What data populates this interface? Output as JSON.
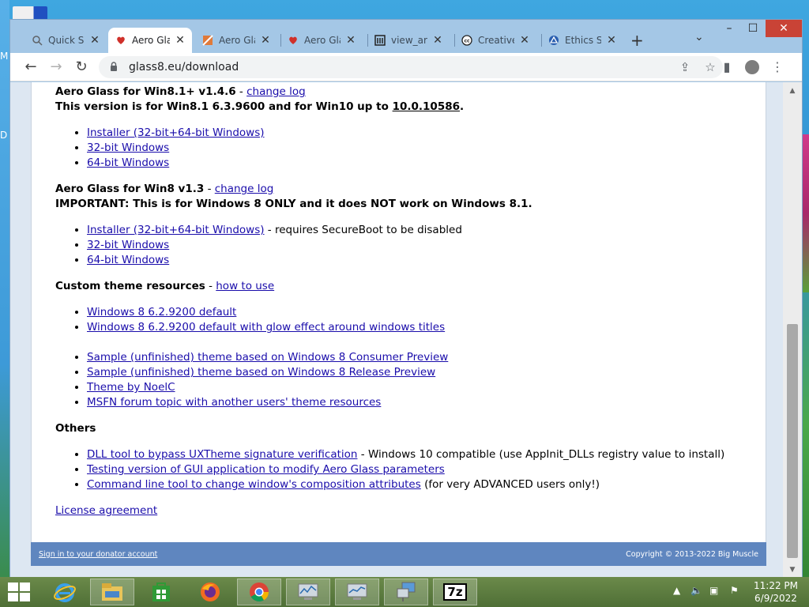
{
  "desktop": {
    "glyph_top": "M",
    "glyph_bottom": "D"
  },
  "browser": {
    "tabs": [
      {
        "title": "Quick Se",
        "icon": "search-icon",
        "active": false
      },
      {
        "title": "Aero Gla",
        "icon": "aero-favicon",
        "active": true
      },
      {
        "title": "Aero Gla",
        "icon": "glass-favicon",
        "active": false
      },
      {
        "title": "Aero Gla",
        "icon": "aero-favicon",
        "active": false
      },
      {
        "title": "view_arc",
        "icon": "archive-favicon",
        "active": false
      },
      {
        "title": "Creative",
        "icon": "cc-favicon",
        "active": false
      },
      {
        "title": "Ethics St",
        "icon": "ethics-favicon",
        "active": false
      }
    ],
    "url": "glass8.eu/download"
  },
  "page": {
    "s1": {
      "title": "Aero Glass for Win8.1+ v1.4.6",
      "sep": " - ",
      "link": "change log",
      "note_prefix": "This version is for Win8.1 6.3.9600 and for Win10 up to ",
      "note_link": "10.0.10586",
      "note_suffix": ".",
      "items": [
        "Installer (32-bit+64-bit Windows)",
        "32-bit Windows",
        "64-bit Windows"
      ]
    },
    "s2": {
      "title": "Aero Glass for Win8 v1.3",
      "sep": " - ",
      "link": "change log",
      "note": "IMPORTANT: This is for Windows 8 ONLY and it does NOT work on Windows 8.1.",
      "items": [
        "Installer (32-bit+64-bit Windows)",
        "32-bit Windows",
        "64-bit Windows"
      ],
      "item1_suffix": " - requires SecureBoot to be disabled"
    },
    "s3": {
      "title": "Custom theme resources",
      "sep": " - ",
      "link": "how to use",
      "items_a": [
        "Windows 8 6.2.9200 default",
        "Windows 8 6.2.9200 default with glow effect around windows titles"
      ],
      "items_b": [
        "Sample (unfinished) theme based on Windows 8 Consumer Preview",
        "Sample (unfinished) theme based on Windows 8 Release Preview",
        "Theme by NoelC",
        "MSFN forum topic with another users' theme resources"
      ]
    },
    "s4": {
      "title": "Others",
      "items": [
        {
          "link": "DLL tool to bypass UXTheme signature verification",
          "suffix": " - Windows 10 compatible (use AppInit_DLLs registry value to install)"
        },
        {
          "link": "Testing version of GUI application to modify Aero Glass parameters",
          "suffix": ""
        },
        {
          "link": "Command line tool to change window's composition attributes",
          "suffix": " (for very ADVANCED users only!)"
        }
      ]
    },
    "license": "License agreement",
    "footer": {
      "signin": "Sign in to your donator account",
      "copyright": "Copyright © 2013-2022 Big Muscle"
    }
  },
  "taskbar": {
    "apps": [
      "internet-explorer",
      "file-explorer",
      "store",
      "firefox",
      "chrome",
      "perf-monitor",
      "perf-monitor-2",
      "network",
      "7zip"
    ],
    "sevenzip_label": "7z",
    "time": "11:22 PM",
    "date": "6/9/2022"
  },
  "colors": {
    "link": "#1a0dab",
    "footer_bg": "#5f86bf",
    "close_button": "#c94336",
    "window_frame": "#a4c7e6"
  }
}
